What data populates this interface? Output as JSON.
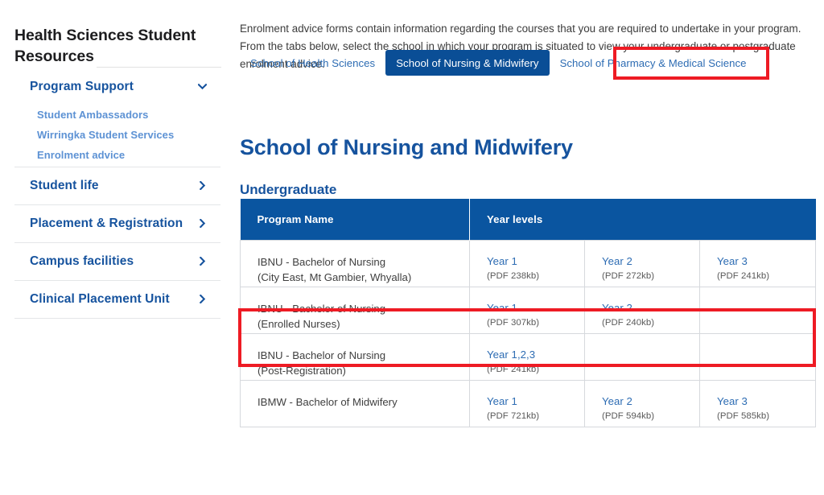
{
  "sidebar": {
    "title": "Health Sciences Student Resources",
    "items": [
      {
        "label": "Program Support",
        "icon": "chevron-down-icon",
        "expanded": true
      },
      {
        "label": "Student life",
        "icon": "chevron-right-icon",
        "expanded": false
      },
      {
        "label": "Placement & Registration",
        "icon": "chevron-right-icon",
        "expanded": false
      },
      {
        "label": "Campus facilities",
        "icon": "chevron-right-icon",
        "expanded": false
      },
      {
        "label": "Clinical Placement Unit",
        "icon": "chevron-right-icon",
        "expanded": false
      }
    ],
    "sub_items": [
      {
        "label": "Student Ambassadors"
      },
      {
        "label": "Wirringka Student Services"
      },
      {
        "label": "Enrolment advice"
      }
    ]
  },
  "main": {
    "intro": "Enrolment advice forms contain information regarding the courses that you are required to undertake in your program. From the tabs below, select the school in which your program is situated to view your undergraduate or postgraduate enrolment advice.",
    "tabs": [
      {
        "label": "School of Health Sciences",
        "active": false
      },
      {
        "label": "School of Nursing & Midwifery",
        "active": true
      },
      {
        "label": "School of Pharmacy & Medical Science",
        "active": false
      }
    ],
    "page_heading": "School of Nursing and Midwifery",
    "section_heading": "Undergraduate",
    "table": {
      "headers": [
        "Program Name",
        "Year levels"
      ],
      "rows": [
        {
          "name_line1": "IBNU - Bachelor of Nursing",
          "name_line2": "(City East, Mt Gambier, Whyalla)",
          "years": [
            {
              "label": "Year 1",
              "size": "(PDF 238kb)"
            },
            {
              "label": "Year 2",
              "size": "(PDF 272kb)"
            },
            {
              "label": "Year 3",
              "size": "(PDF 241kb)"
            }
          ]
        },
        {
          "name_line1": "IBNU - Bachelor of Nursing",
          "name_line2": "(Enrolled Nurses)",
          "years": [
            {
              "label": "Year 1",
              "size": "(PDF 307kb)"
            },
            {
              "label": "Year 2",
              "size": "(PDF 240kb)"
            },
            {
              "label": "",
              "size": ""
            }
          ]
        },
        {
          "name_line1": "IBNU - Bachelor of Nursing",
          "name_line2": "(Post-Registration)",
          "years": [
            {
              "label": "Year 1,2,3",
              "size": "(PDF 241kb)"
            },
            {
              "label": "",
              "size": ""
            },
            {
              "label": "",
              "size": ""
            }
          ]
        },
        {
          "name_line1": "IBMW - Bachelor of Midwifery",
          "name_line2": "",
          "years": [
            {
              "label": "Year 1",
              "size": "(PDF 721kb)"
            },
            {
              "label": "Year 2",
              "size": "(PDF 594kb)"
            },
            {
              "label": "Year 3",
              "size": "(PDF 585kb)"
            }
          ]
        }
      ]
    }
  },
  "annotations": {
    "color": "#ee1b24",
    "tab_highlight_target": "School of Nursing & Midwifery",
    "row_highlight_target": "IBNU - Bachelor of Nursing (Enrolled Nurses)"
  }
}
